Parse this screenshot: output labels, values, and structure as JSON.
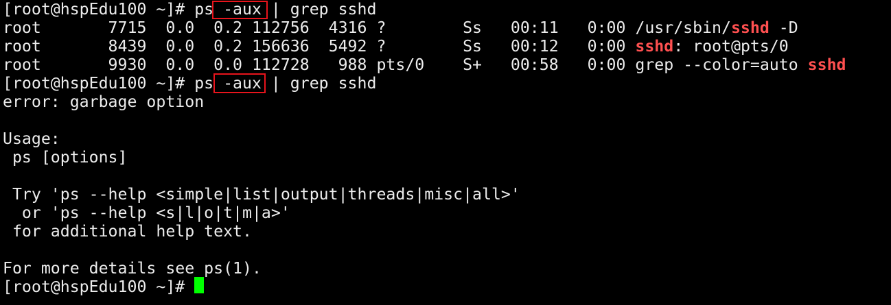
{
  "terminal": {
    "colors": {
      "background": "#000000",
      "text": "#ececec",
      "match_highlight": "#ff5050",
      "cursor": "#00ff00",
      "annotation_box": "#e8141c"
    },
    "lines": [
      {
        "segments": [
          {
            "text": "[root@hspEdu100 ~]# ps -aux | grep sshd"
          }
        ]
      },
      {
        "segments": [
          {
            "text": "root       7715  0.0  0.2 112756  4316 ?        Ss   00:11   0:00 /usr/sbin/"
          },
          {
            "text": "sshd",
            "hl": true
          },
          {
            "text": " -D"
          }
        ]
      },
      {
        "segments": [
          {
            "text": "root       8439  0.0  0.2 156636  5492 ?        Ss   00:12   0:00 "
          },
          {
            "text": "sshd",
            "hl": true
          },
          {
            "text": ": root@pts/0"
          }
        ]
      },
      {
        "segments": [
          {
            "text": "root       9930  0.0  0.0 112728   988 pts/0    S+   00:58   0:00 grep --color=auto "
          },
          {
            "text": "sshd",
            "hl": true
          }
        ]
      },
      {
        "segments": [
          {
            "text": "[root@hspEdu100 ~]# ps -aux | grep sshd"
          }
        ]
      },
      {
        "segments": [
          {
            "text": "error: garbage option"
          }
        ]
      },
      {
        "segments": [
          {
            "text": ""
          }
        ]
      },
      {
        "segments": [
          {
            "text": "Usage:"
          }
        ]
      },
      {
        "segments": [
          {
            "text": " ps [options]"
          }
        ]
      },
      {
        "segments": [
          {
            "text": ""
          }
        ]
      },
      {
        "segments": [
          {
            "text": " Try 'ps --help <simple|list|output|threads|misc|all>'"
          }
        ]
      },
      {
        "segments": [
          {
            "text": "  or 'ps --help <s|l|o|t|m|a>'"
          }
        ]
      },
      {
        "segments": [
          {
            "text": " for additional help text."
          }
        ]
      },
      {
        "segments": [
          {
            "text": ""
          }
        ]
      },
      {
        "segments": [
          {
            "text": "For more details see ps(1)."
          }
        ]
      },
      {
        "segments": [
          {
            "text": "[root@hspEdu100 ~]# "
          }
        ]
      }
    ]
  }
}
